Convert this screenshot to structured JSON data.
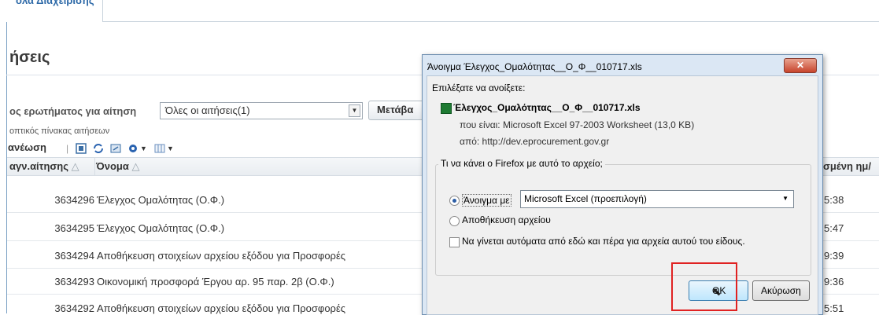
{
  "app": {
    "tab_label": "όλα Διαχείρισης",
    "page_title": "ήσεις",
    "query_label": "ος ερωτήματος για αίτηση",
    "query_select_value": "Όλες οι αιτήσεις(1)",
    "go_button": "Μετάβα",
    "table_caption": "οπτικός πίνακας αιτήσεων",
    "refresh_label": "ανέωση",
    "toolbar_separator": "|",
    "icons": [
      "detach-icon",
      "refresh-icon",
      "export-icon",
      "gear-icon",
      "columns-icon"
    ],
    "columns": {
      "id": "αγν.αίτησης",
      "name": "Όνομα",
      "date": "σμένη ημ/"
    },
    "rows": [
      {
        "id": "3634296",
        "name": "Έλεγχος Ομαλότητας (Ο.Φ.)",
        "time": "5:38"
      },
      {
        "id": "3634295",
        "name": "Έλεγχος Ομαλότητας (Ο.Φ.)",
        "time": "5:47"
      },
      {
        "id": "3634294",
        "name": "Αποθήκευση στοιχείων αρχείου εξόδου για Προσφορές",
        "time": "9:39"
      },
      {
        "id": "3634293",
        "name": "Οικονομική προσφορά Έργου αρ. 95 παρ. 2β (Ο.Φ.)",
        "time": "9:36"
      },
      {
        "id": "3634292",
        "name": "Αποθήκευση στοιχείων αρχείου εξόδου για Προσφορές",
        "time": "5:51"
      }
    ]
  },
  "dialog": {
    "title": "Άνοιγμα Έλεγχος_Ομαλότητας__Ο_Φ__010717.xls",
    "close": "✕",
    "choose_text": "Επιλέξατε να ανοίξετε:",
    "filename": "Έλεγχος_Ομαλότητας__Ο_Φ__010717.xls",
    "kind": "που είναι: Microsoft Excel 97-2003 Worksheet (13,0 KB)",
    "from": "από: http://dev.eprocurement.gov.gr",
    "group_title": "Τι να κάνει ο Firefox  με αυτό το αρχείο;",
    "open_with_label": "Άνοιγμα με",
    "open_with_value": "Microsoft Excel (προεπιλογή)",
    "save_label": "Αποθήκευση αρχείου",
    "auto_label": "Να γίνεται αυτόματα από εδώ και πέρα για αρχεία αυτού του είδους.",
    "ok": "OK",
    "cancel": "Ακύρωση",
    "accent_color": "#e02222"
  }
}
